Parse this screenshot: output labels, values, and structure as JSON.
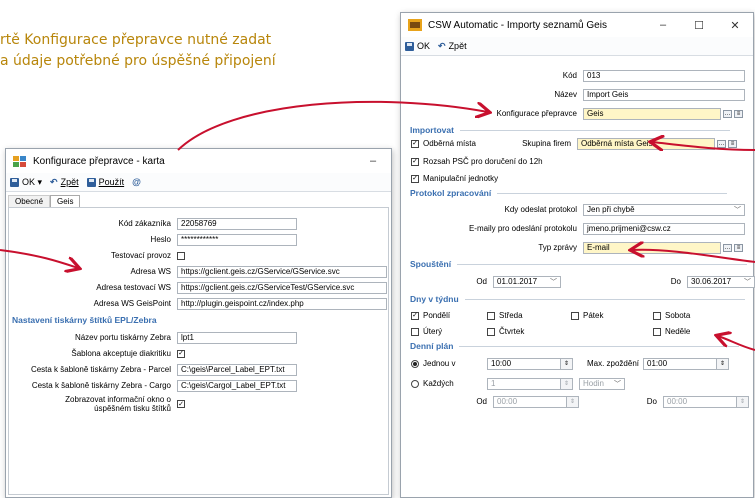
{
  "annotation": {
    "line1": "rtě Konfigurace přepravce nutné zadat",
    "line2": "a údaje potřebné pro úspěšné připojení"
  },
  "left_window": {
    "title": "Konfigurace přepravce - karta",
    "toolbar": {
      "ok": "OK",
      "back": "Zpět",
      "use": "Použít"
    },
    "tabs": [
      "Obecné",
      "Geis"
    ],
    "fields": [
      {
        "label": "Kód zákazníka",
        "value": "22058769"
      },
      {
        "label": "Heslo",
        "value": "************"
      },
      {
        "label": "Testovací provoz",
        "checked": false
      },
      {
        "label": "Adresa WS",
        "value": "https://gclient.geis.cz/GService/GService.svc"
      },
      {
        "label": "Adresa testovací WS",
        "value": "https://gclient.geis.cz/GServiceTest/GService.svc"
      },
      {
        "label": "Adresa WS GeisPoint",
        "value": "http://plugin.geispoint.cz/index.php"
      }
    ],
    "section_label": "Nastavení tiskárny štítků EPL/Zebra",
    "label_fields": [
      {
        "label": "Název portu tiskárny Zebra",
        "value": "lpt1"
      },
      {
        "label": "Šablona akceptuje diakritiku",
        "checked": true
      },
      {
        "label": "Cesta k šabloně tiskárny Zebra - Parcel",
        "value": "C:\\geis\\Parcel_Label_EPT.txt"
      },
      {
        "label": "Cesta k šabloně tiskárny Zebra - Cargo",
        "value": "C:\\geis\\Cargol_Label_EPT.txt"
      },
      {
        "label1": "Zobrazovat informační okno o",
        "label2": "úspěšném tisku štítků",
        "checked": true
      }
    ]
  },
  "right_window": {
    "title": "CSW Automatic - Importy seznamů Geis",
    "toolbar": {
      "ok": "OK",
      "back": "Zpět"
    },
    "kod_label": "Kód",
    "kod_value": "013",
    "nazev_label": "Název",
    "nazev_value": "Import Geis",
    "konfig_label": "Konfigurace přepravce",
    "konfig_value": "Geis",
    "importovat": "Importovat",
    "odberna_mista": "Odběrná místa",
    "skupina_label": "Skupina firem",
    "skupina_value": "Odběrná místa Geis",
    "rozsah_psc": "Rozsah PSČ pro doručení do 12h",
    "manipulacni": "Manipulační jednotky",
    "protokol": "Protokol zpracování",
    "kdy_label": "Kdy odeslat protokol",
    "kdy_value": "Jen při chybě",
    "emaily_label": "E-maily pro odeslání protokolu",
    "emaily_value": "jmeno.prijmeni@csw.cz",
    "typ_label": "Typ zprávy",
    "typ_value": "E-mail",
    "spousteni": "Spouštění",
    "od_label": "Od",
    "od_value": "01.01.2017",
    "do_label": "Do",
    "do_value": "30.06.2017",
    "dny": "Dny v týdnu",
    "days": [
      {
        "name": "Pondělí",
        "checked": true
      },
      {
        "name": "Středa",
        "checked": false
      },
      {
        "name": "Pátek",
        "checked": false
      },
      {
        "name": "Sobota",
        "checked": false
      },
      {
        "name": "Úterý",
        "checked": false
      },
      {
        "name": "Čtvrtek",
        "checked": false
      },
      {
        "name": "Neděle",
        "checked": false
      }
    ],
    "denni_plan": "Denní plán",
    "jednou": "Jednou v",
    "jednou_value": "10:00",
    "max_label": "Max. zpoždění",
    "max_value": "01:00",
    "kazdych": "Každých",
    "kazdych_value": "1",
    "hodin": "Hodin",
    "od2_label": "Od",
    "od2_value": "00:00",
    "do2_label": "Do",
    "do2_value": "00:00"
  },
  "colors": {
    "accent": "#3a6fb0",
    "arrow": "#c8102e",
    "annotation": "#b8860b",
    "highlight": "#fff6c7"
  }
}
